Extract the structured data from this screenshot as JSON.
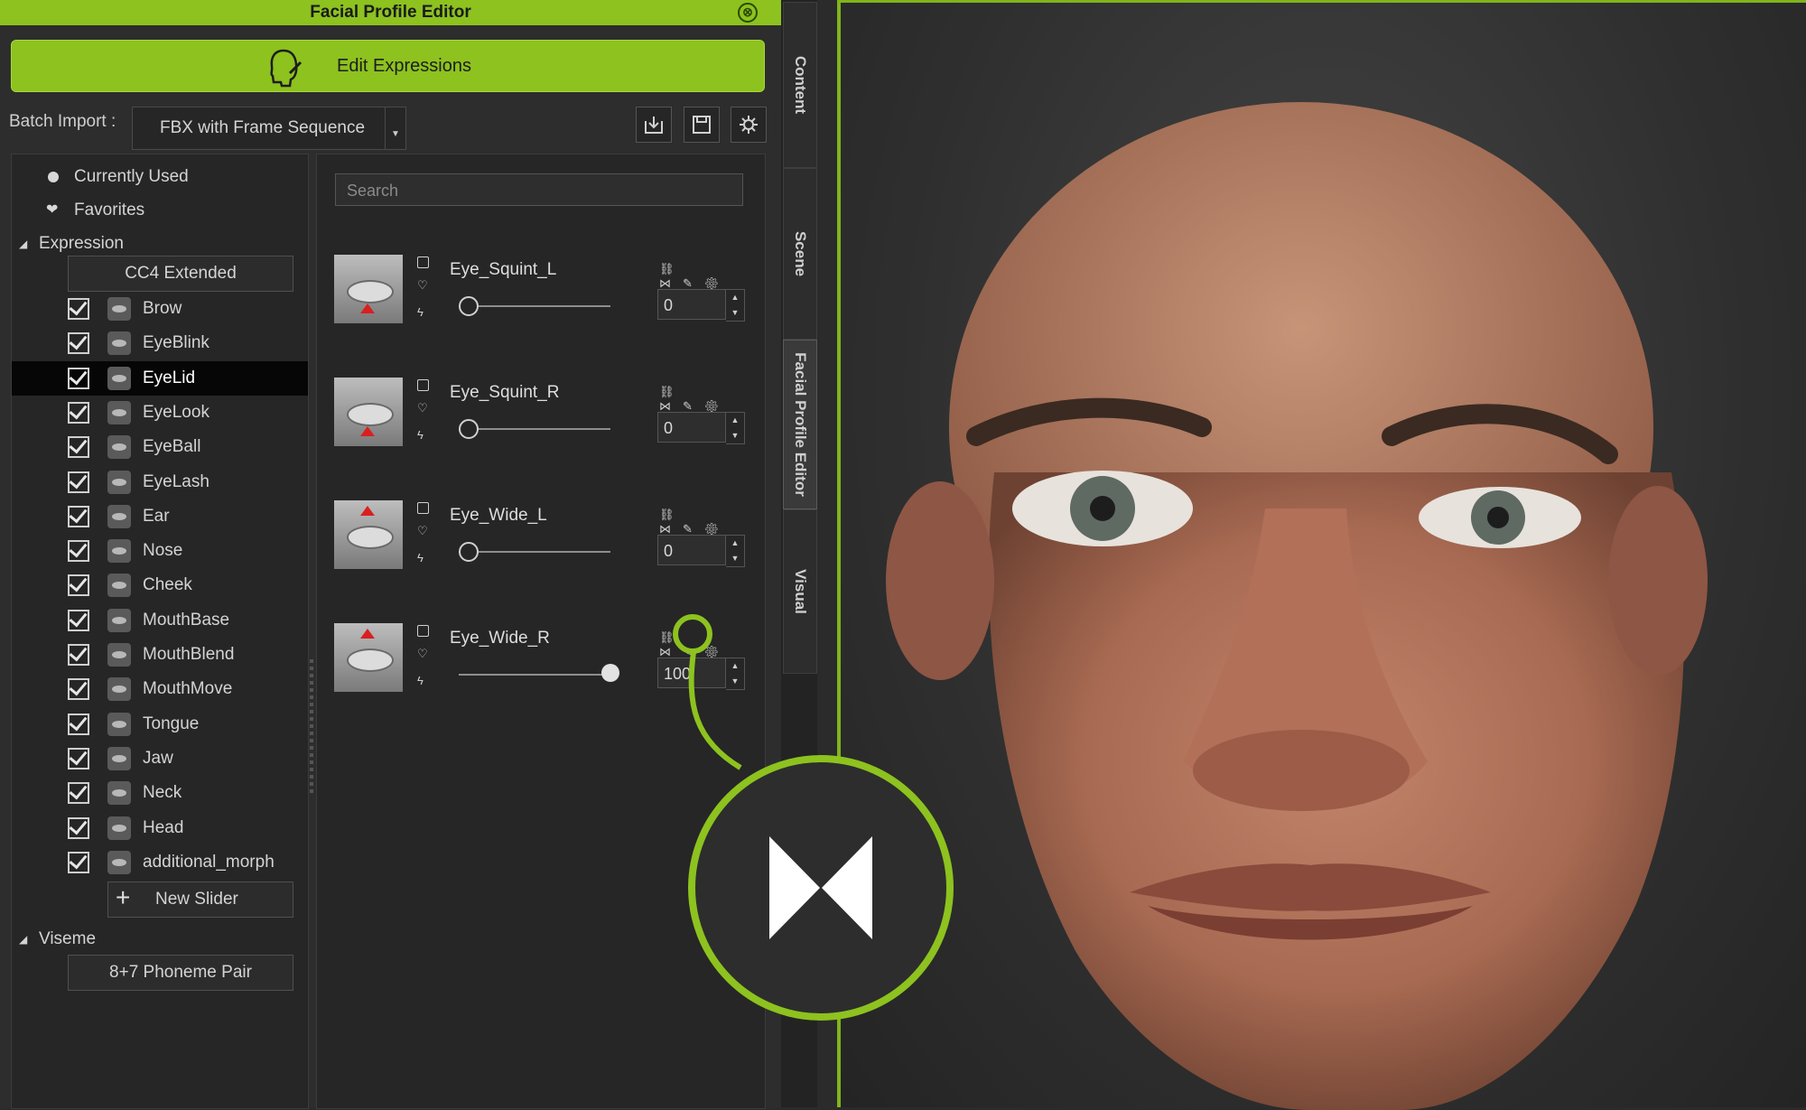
{
  "window": {
    "title": "Facial Profile Editor",
    "close_glyph": "⊗"
  },
  "edit_button": {
    "label": "Edit Expressions",
    "icon": "face-edit-icon"
  },
  "batch_import": {
    "label": "Batch Import :",
    "value": "FBX with Frame Sequence",
    "arrow": "▼"
  },
  "toolbar": {
    "icons": [
      "import-icon",
      "save-icon",
      "gear-icon"
    ]
  },
  "tree": {
    "currently_used": "Currently Used",
    "favorites": "Favorites",
    "expression_header": "Expression",
    "expression_group_button": "CC4 Extended",
    "items": [
      {
        "label": "Brow"
      },
      {
        "label": "EyeBlink"
      },
      {
        "label": "EyeLid"
      },
      {
        "label": "EyeLook"
      },
      {
        "label": "EyeBall"
      },
      {
        "label": "EyeLash"
      },
      {
        "label": "Ear"
      },
      {
        "label": "Nose"
      },
      {
        "label": "Cheek"
      },
      {
        "label": "MouthBase"
      },
      {
        "label": "MouthBlend"
      },
      {
        "label": "MouthMove"
      },
      {
        "label": "Tongue"
      },
      {
        "label": "Jaw"
      },
      {
        "label": "Neck"
      },
      {
        "label": "Head"
      },
      {
        "label": "additional_morph"
      }
    ],
    "selected": "EyeLid",
    "new_slider": "New Slider",
    "new_slider_glyph": "+",
    "viseme_header": "Viseme",
    "viseme_group_button": "8+7 Phoneme Pair"
  },
  "search": {
    "placeholder": "Search"
  },
  "sliders": [
    {
      "name": "Eye_Squint_L",
      "value": "0",
      "level": 0
    },
    {
      "name": "Eye_Squint_R",
      "value": "0",
      "level": 0
    },
    {
      "name": "Eye_Wide_L",
      "value": "0",
      "level": 0
    },
    {
      "name": "Eye_Wide_R",
      "value": "100",
      "level": 1
    }
  ],
  "side_tabs": [
    {
      "label": "Content"
    },
    {
      "label": "Scene"
    },
    {
      "label": "Facial Profile Editor"
    },
    {
      "label": "Visual"
    }
  ],
  "callout": {
    "icon": "mirror-icon"
  },
  "colors": {
    "accent": "#8dc21f",
    "panel": "#2d2d2d",
    "selected_row": "#060606"
  }
}
